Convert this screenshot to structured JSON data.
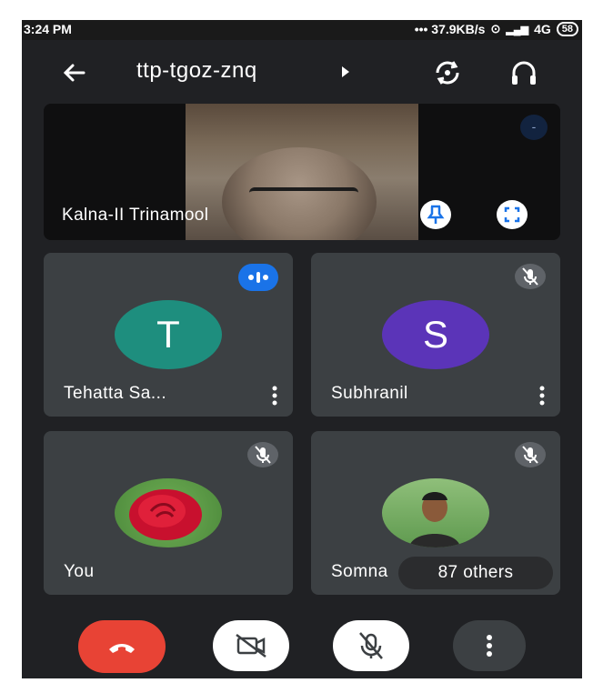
{
  "status_bar": {
    "time": "3:24 PM",
    "net_speed": "••• 37.9KB/s",
    "network": "4G",
    "battery": "58"
  },
  "header": {
    "meeting_code": "ttp-tgoz-znq"
  },
  "featured": {
    "name": "Kalna-II Trinamool",
    "badge": "-"
  },
  "participants": [
    {
      "name": "Tehatta Sa...",
      "initial": "T",
      "avatar_color": "#1e8e7e",
      "status": "speaking"
    },
    {
      "name": "Subhranil",
      "initial": "S",
      "avatar_color": "#5b34b8",
      "status": "muted"
    },
    {
      "name": "You",
      "initial": "",
      "avatar": "rose-photo",
      "status": "muted"
    },
    {
      "name": "Somna",
      "initial": "",
      "avatar": "person-photo",
      "status": "muted",
      "others_label": "87 others"
    }
  ],
  "colors": {
    "background": "#202124",
    "tile": "#3c4043",
    "end_call": "#e84335",
    "speaking": "#1a73e8"
  }
}
